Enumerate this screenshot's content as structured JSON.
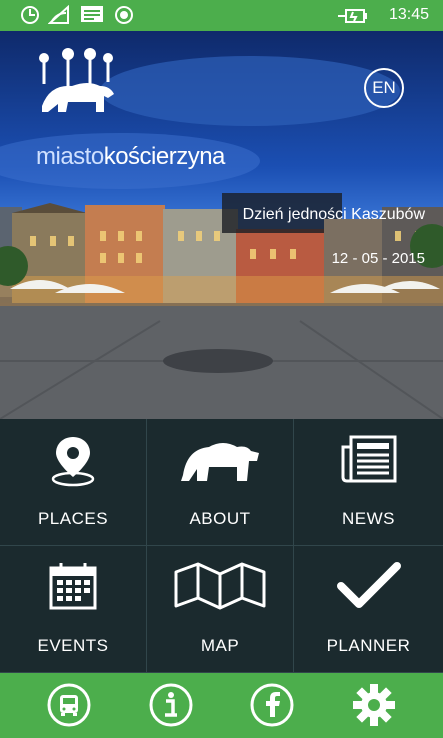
{
  "status_bar": {
    "time": "13:45"
  },
  "header": {
    "brand_prefix": "miasto",
    "brand_suffix": "kościerzyna",
    "language_button": "EN"
  },
  "featured_event": {
    "title": "Dzień jedności Kaszubów",
    "date": "12 - 05 - 2015"
  },
  "menu": {
    "places": "PLACES",
    "about": "ABOUT",
    "news": "NEWS",
    "events": "EVENTS",
    "map": "MAP",
    "planner": "PLANNER"
  },
  "bottom_bar": {
    "icons": [
      "bus-icon",
      "info-icon",
      "facebook-icon",
      "gear-icon"
    ]
  }
}
